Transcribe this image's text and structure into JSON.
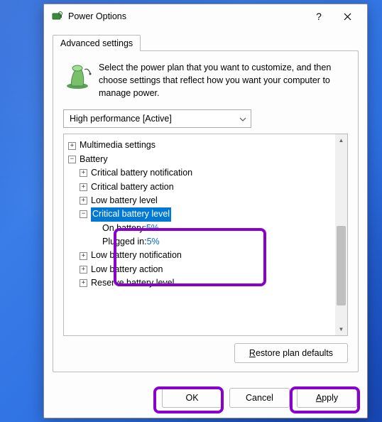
{
  "dialog": {
    "title": "Power Options",
    "tab_label": "Advanced settings",
    "intro": "Select the power plan that you want to customize, and then choose settings that reflect how you want your computer to manage power.",
    "plan_selected": "High performance [Active]"
  },
  "tree": {
    "multimedia": "Multimedia settings",
    "battery": "Battery",
    "crit_notify": "Critical battery notification",
    "crit_action": "Critical battery action",
    "low_level": "Low battery level",
    "crit_level": "Critical battery level",
    "on_battery_label": "On battery: ",
    "on_battery_val": "5%",
    "plugged_label": "Plugged in: ",
    "plugged_val": "5%",
    "low_notify": "Low battery notification",
    "low_action": "Low battery action",
    "reserve": "Reserve battery level"
  },
  "buttons": {
    "restore_pre": "R",
    "restore_post": "estore plan defaults",
    "ok": "OK",
    "cancel": "Cancel",
    "apply_pre": "A",
    "apply_post": "pply"
  }
}
